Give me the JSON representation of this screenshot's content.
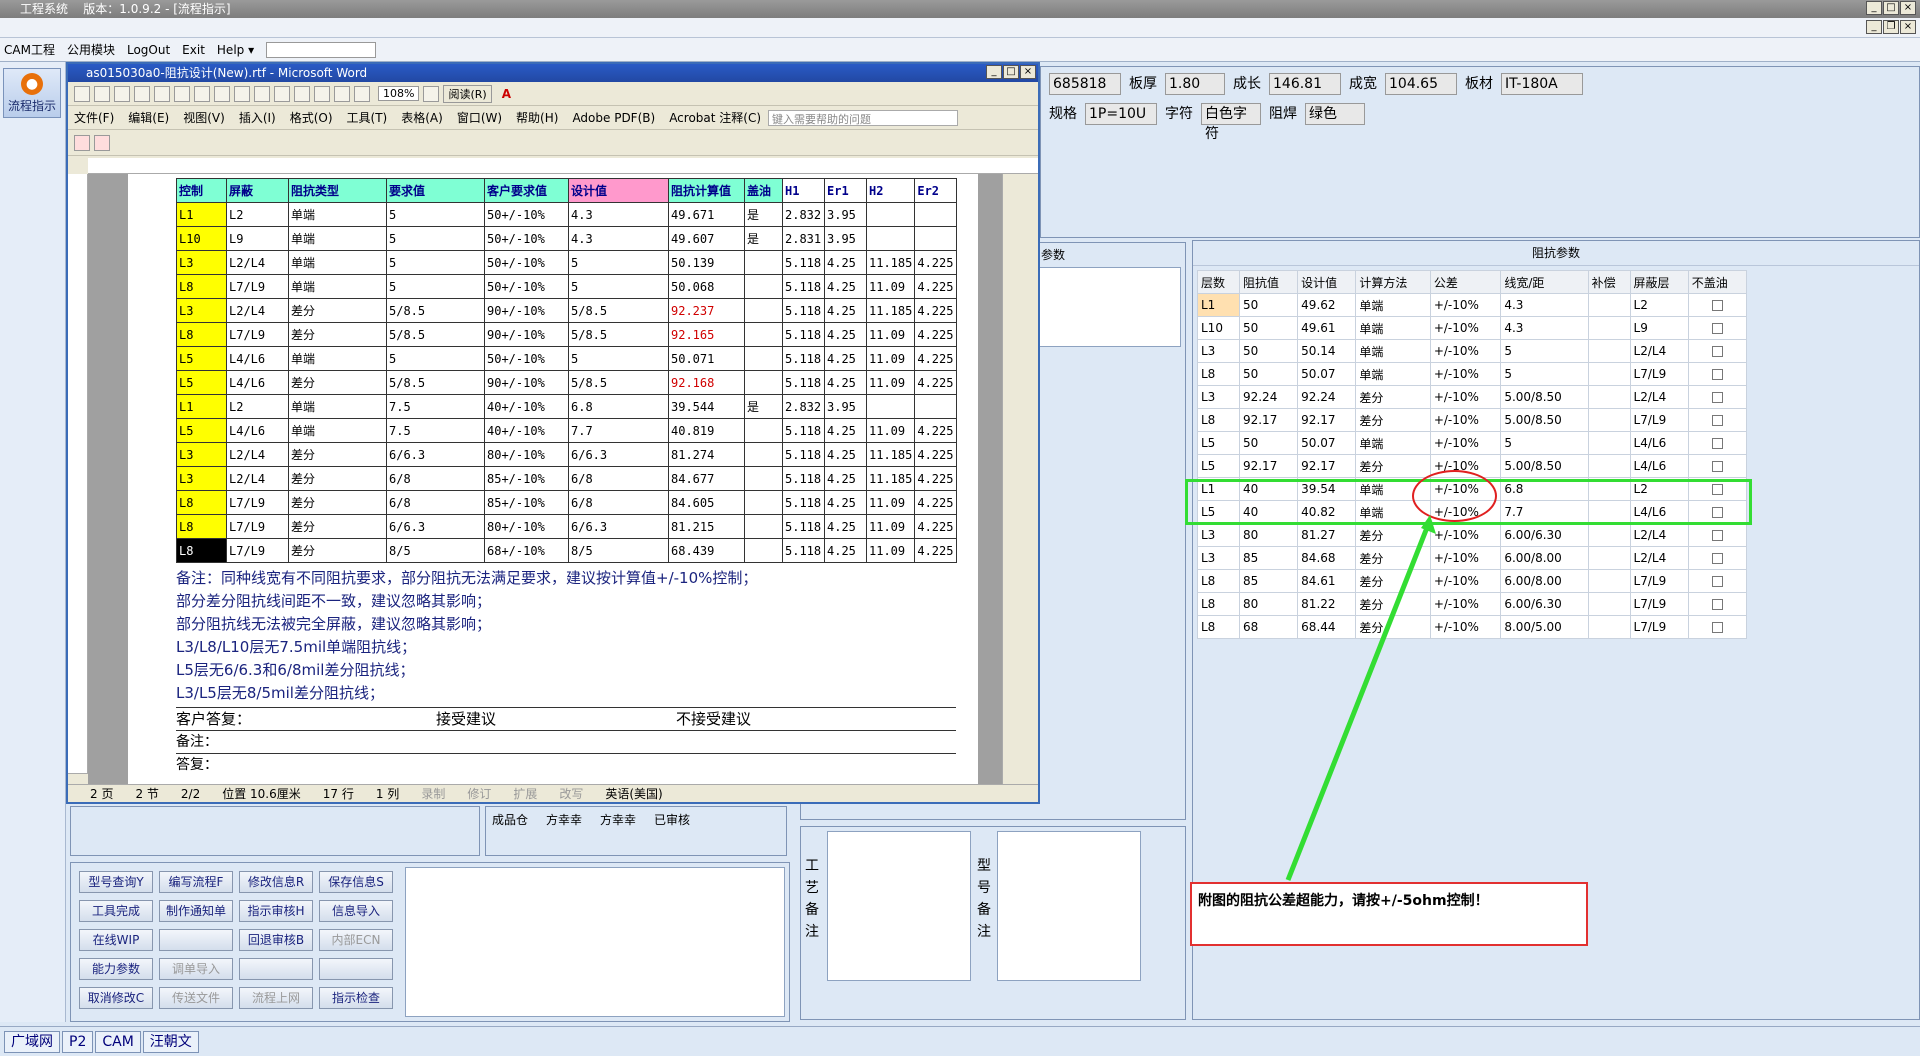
{
  "app": {
    "title": "工程系统",
    "version": "版本：1.0.9.2 - [流程指示]"
  },
  "menu": [
    "CAM工程",
    "公用模块",
    "LogOut",
    "Exit",
    "Help ▾"
  ],
  "left": {
    "flow_btn": "流程指示"
  },
  "header_fields": [
    {
      "label": "",
      "value": "685818"
    },
    {
      "label": "板厚",
      "value": "1.80"
    },
    {
      "label": "成长",
      "value": "146.81"
    },
    {
      "label": "成宽",
      "value": "104.65"
    },
    {
      "label": "板材",
      "value": "IT-180A"
    }
  ],
  "header_fields2": [
    {
      "label": "规格",
      "value": "1P=10U"
    },
    {
      "label": "字符",
      "value": "白色字符"
    },
    {
      "label": "阻焊",
      "value": "绿色"
    }
  ],
  "imp_panel": {
    "title": "阻抗参数",
    "left_title": "参数",
    "columns": [
      "层数",
      "阻抗值",
      "设计值",
      "计算方法",
      "公差",
      "线宽/距",
      "补偿",
      "屏蔽层",
      "不盖油"
    ],
    "rows": [
      [
        "L1",
        "50",
        "49.62",
        "单端",
        "+/-10%",
        "4.3",
        "",
        "L2"
      ],
      [
        "L10",
        "50",
        "49.61",
        "单端",
        "+/-10%",
        "4.3",
        "",
        "L9"
      ],
      [
        "L3",
        "50",
        "50.14",
        "单端",
        "+/-10%",
        "5",
        "",
        "L2/L4"
      ],
      [
        "L8",
        "50",
        "50.07",
        "单端",
        "+/-10%",
        "5",
        "",
        "L7/L9"
      ],
      [
        "L3",
        "92.24",
        "92.24",
        "差分",
        "+/-10%",
        "5.00/8.50",
        "",
        "L2/L4"
      ],
      [
        "L8",
        "92.17",
        "92.17",
        "差分",
        "+/-10%",
        "5.00/8.50",
        "",
        "L7/L9"
      ],
      [
        "L5",
        "50",
        "50.07",
        "单端",
        "+/-10%",
        "5",
        "",
        "L4/L6"
      ],
      [
        "L5",
        "92.17",
        "92.17",
        "差分",
        "+/-10%",
        "5.00/8.50",
        "",
        "L4/L6"
      ],
      [
        "L1",
        "40",
        "39.54",
        "单端",
        "+/-10%",
        "6.8",
        "",
        "L2"
      ],
      [
        "L5",
        "40",
        "40.82",
        "单端",
        "+/-10%",
        "7.7",
        "",
        "L4/L6"
      ],
      [
        "L3",
        "80",
        "81.27",
        "差分",
        "+/-10%",
        "6.00/6.30",
        "",
        "L2/L4"
      ],
      [
        "L3",
        "85",
        "84.68",
        "差分",
        "+/-10%",
        "6.00/8.00",
        "",
        "L2/L4"
      ],
      [
        "L8",
        "85",
        "84.61",
        "差分",
        "+/-10%",
        "6.00/8.00",
        "",
        "L7/L9"
      ],
      [
        "L8",
        "80",
        "81.22",
        "差分",
        "+/-10%",
        "6.00/6.30",
        "",
        "L7/L9"
      ],
      [
        "L8",
        "68",
        "68.44",
        "差分",
        "+/-10%",
        "8.00/5.00",
        "",
        "L7/L9"
      ]
    ]
  },
  "annotation": "附图的阻抗公差超能力，请按+/-5ohm控制！",
  "memo": {
    "craft": "工艺备注",
    "model": "型号备注"
  },
  "approval_row": [
    "成品仓",
    "方幸幸",
    "方幸幸",
    "已审核"
  ],
  "buttons": [
    [
      "型号查询Y",
      "编写流程F",
      "修改信息R",
      "保存信息S"
    ],
    [
      "工具完成",
      "制作通知单",
      "指示审核H",
      "信息导入"
    ],
    [
      "在线WIP",
      "",
      "回退审核B",
      "内部ECN"
    ],
    [
      "能力参数",
      "调单导入",
      "",
      ""
    ],
    [
      "取消修改C",
      "传送文件",
      "流程上网",
      "指示检查"
    ]
  ],
  "status": [
    "广域网",
    "P2",
    "CAM",
    "汪朝文"
  ],
  "word": {
    "title": "as015030a0-阻抗设计(New).rtf - Microsoft Word",
    "zoom": "108%",
    "read": "阅读(R)",
    "menu": [
      "文件(F)",
      "编辑(E)",
      "视图(V)",
      "插入(I)",
      "格式(O)",
      "工具(T)",
      "表格(A)",
      "窗口(W)",
      "帮助(H)",
      "Adobe PDF(B)",
      "Acrobat 注释(C)"
    ],
    "help_box": "键入需要帮助的问题",
    "columns": [
      "控制",
      "屏蔽",
      "阻抗类型",
      "要求值",
      "客户要求值",
      "设计值",
      "阻抗计算值",
      "盖油",
      "H1",
      "Er1",
      "H2",
      "Er2"
    ],
    "rows": [
      [
        "L1",
        "L2",
        "单端",
        "5",
        "50+/-10%",
        "4.3",
        "49.671",
        "是",
        "2.832",
        "3.95",
        "",
        ""
      ],
      [
        "L10",
        "L9",
        "单端",
        "5",
        "50+/-10%",
        "4.3",
        "49.607",
        "是",
        "2.831",
        "3.95",
        "",
        ""
      ],
      [
        "L3",
        "L2/L4",
        "单端",
        "5",
        "50+/-10%",
        "5",
        "50.139",
        "",
        "5.118",
        "4.25",
        "11.185",
        "4.225"
      ],
      [
        "L8",
        "L7/L9",
        "单端",
        "5",
        "50+/-10%",
        "5",
        "50.068",
        "",
        "5.118",
        "4.25",
        "11.09",
        "4.225"
      ],
      [
        "L3",
        "L2/L4",
        "差分",
        "5/8.5",
        "90+/-10%",
        "5/8.5",
        "92.237",
        "",
        "5.118",
        "4.25",
        "11.185",
        "4.225"
      ],
      [
        "L8",
        "L7/L9",
        "差分",
        "5/8.5",
        "90+/-10%",
        "5/8.5",
        "92.165",
        "",
        "5.118",
        "4.25",
        "11.09",
        "4.225"
      ],
      [
        "L5",
        "L4/L6",
        "单端",
        "5",
        "50+/-10%",
        "5",
        "50.071",
        "",
        "5.118",
        "4.25",
        "11.09",
        "4.225"
      ],
      [
        "L5",
        "L4/L6",
        "差分",
        "5/8.5",
        "90+/-10%",
        "5/8.5",
        "92.168",
        "",
        "5.118",
        "4.25",
        "11.09",
        "4.225"
      ],
      [
        "L1",
        "L2",
        "单端",
        "7.5",
        "40+/-10%",
        "6.8",
        "39.544",
        "是",
        "2.832",
        "3.95",
        "",
        ""
      ],
      [
        "L5",
        "L4/L6",
        "单端",
        "7.5",
        "40+/-10%",
        "7.7",
        "40.819",
        "",
        "5.118",
        "4.25",
        "11.09",
        "4.225"
      ],
      [
        "L3",
        "L2/L4",
        "差分",
        "6/6.3",
        "80+/-10%",
        "6/6.3",
        "81.274",
        "",
        "5.118",
        "4.25",
        "11.185",
        "4.225"
      ],
      [
        "L3",
        "L2/L4",
        "差分",
        "6/8",
        "85+/-10%",
        "6/8",
        "84.677",
        "",
        "5.118",
        "4.25",
        "11.185",
        "4.225"
      ],
      [
        "L8",
        "L7/L9",
        "差分",
        "6/8",
        "85+/-10%",
        "6/8",
        "84.605",
        "",
        "5.118",
        "4.25",
        "11.09",
        "4.225"
      ],
      [
        "L8",
        "L7/L9",
        "差分",
        "6/6.3",
        "80+/-10%",
        "6/6.3",
        "81.215",
        "",
        "5.118",
        "4.25",
        "11.09",
        "4.225"
      ],
      [
        "L8",
        "L7/L9",
        "差分",
        "8/5",
        "68+/-10%",
        "8/5",
        "68.439",
        "",
        "5.118",
        "4.25",
        "11.09",
        "4.225"
      ]
    ],
    "notes": [
      "备注：同种线宽有不同阻抗要求，部分阻抗无法满足要求，建议按计算值+/-10%控制；",
      "部分差分阻抗线间距不一致，建议忽略其影响；",
      "部分阻抗线无法被完全屏蔽，建议忽略其影响；",
      "L3/L8/L10层无7.5mil单端阻抗线；",
      "L5层无6/6.3和6/8mil差分阻抗线；",
      "L3/L5层无8/5mil差分阻抗线；"
    ],
    "reply_label": "客户答复：",
    "accept": "接受建议",
    "reject": "不接受建议",
    "memo_label": "备注：",
    "answer_label": "答复：",
    "status": [
      "2 页",
      "2 节",
      "2/2",
      "位置 10.6厘米",
      "17 行",
      "1 列",
      "录制",
      "修订",
      "扩展",
      "改写",
      "英语(美国)"
    ]
  }
}
